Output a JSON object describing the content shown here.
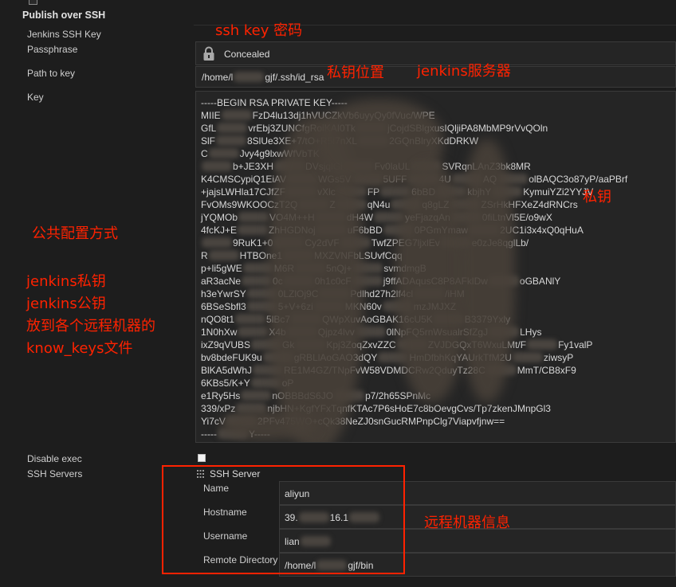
{
  "section_title": "Publish over SSH",
  "fields": {
    "jenkins_ssh_key_label": "Jenkins SSH Key",
    "passphrase_label": "Passphrase",
    "passphrase_icon": "lock-icon",
    "passphrase_value": "Concealed",
    "path_to_key_label": "Path to key",
    "path_to_key_value": [
      "/home/l",
      "gjf/.ssh/id_rsa"
    ],
    "key_label": "Key",
    "key_lines": [
      [
        "-----BEGIN RSA PRIVATE KEY-----"
      ],
      [
        "MIIE",
        "FzD4lu13dj1hVUCZkVb6uyyQy0fVuc/WPE"
      ],
      [
        "GfL",
        "vrEbj3ZUNCfgRoiKAI0Tk",
        "jCojdSBlgxusIQljiPA8MbMP9rVvQOln"
      ],
      [
        "SlF",
        "8SlUe3XE+7/tO+R5i7nXL",
        "2GQnBlryXKdDRKW"
      ],
      [
        "C",
        "Jvy4g9lxwWfVbTK"
      ],
      [
        "",
        "b+JE3XH",
        "DVsjqlGi",
        "Fv0laUL",
        "SVRqnLAnZ3bk8MR"
      ],
      [
        "K4CMSCypiQ1EiAV",
        "WGs5V",
        "5UFF",
        "4U",
        "AQ",
        "olBAQC3o87yP/aaPBrf"
      ],
      [
        "+jajsLWHla17CJfZF",
        "vXlc",
        "FP",
        "6bBD",
        "kbjhY",
        "KymuiYZi2YYJV"
      ],
      [
        "FvOMs9WKOOCzT2Q",
        "Z",
        "qN4u",
        "q8gLZ",
        "ZSrHkHFXeZ4dRNCrs"
      ],
      [
        "jYQMOb",
        "VO4M++H",
        "dH4W",
        "yeFjazqAn",
        "0fiLtnVl5E/o9wX"
      ],
      [
        "4fcKJ+E",
        "ZhHGDNoj",
        "uF6bBD",
        "0PGmYmaw",
        "2UC1i3x4xQ0qHuA"
      ],
      [
        "",
        "9RuK1+0",
        "Cy2dVF",
        "TwfZPEG7ljxlEv",
        "e0zJe8qglLb/"
      ],
      [
        "R",
        "HTBOne1",
        "MXZVNFbLSUvfCqq"
      ],
      [
        "p+li5gWE",
        "M6R",
        "5nQj+",
        "svmdmgB"
      ],
      [
        "aR3acNe",
        "0c",
        "0h1c0cF",
        "j9ffADAqusC8P8AFklDw",
        "oGBANlY"
      ],
      [
        "h3eYwrSY",
        "0LZlOj9C",
        "Pdlhd27h2lf4cl",
        "/iHM"
      ],
      [
        "6BSeSbfl3",
        "5+V+6zi",
        "MKN60v",
        "mzJMJXZ"
      ],
      [
        "nQO8t1",
        "5lBc7",
        "QWpXuvAoGBAK16cU5K",
        "B3379Yxly"
      ],
      [
        "1N0hXw",
        "X4b",
        "Qjpz4lvv",
        "0lNpFQ5rnWsualrSfZgJ",
        "LHys"
      ],
      [
        "ixZ9qVUBS",
        "Gk",
        "Kpj3ZoqZxvZZC",
        "ZVJDGQxT6WxuLMt/F",
        "Fy1valP"
      ],
      [
        "bv8bdeFUK9u",
        "gRBLlAoGAO3dQY",
        "HmDfbhKqYAUrkTfM2U",
        "ziwsyP"
      ],
      [
        "BlKA5dWhJ",
        "RE1M4GZ/TNpFvW58VDMDCRw2QduyTz28C",
        "MmT/CB8xF9"
      ],
      [
        "6KBs5/K+Y",
        "oP"
      ],
      [
        "e1Ry5Hs",
        "nOBBBdS6JO",
        "p7/2h65SPnMc"
      ],
      [
        "339/xPz",
        "njbHN+KgfYFxTqnfKTAc7P6sHoE7c8bOevgCvs/Tp7zkenJMnpGl3"
      ],
      [
        "Yi7cV",
        "2PFv475WO+cQk38NeZJ0snGucRMPnpClg7Viapvfjnw=="
      ],
      [
        "-----",
        "Y-----"
      ]
    ],
    "disable_exec_label": "Disable exec",
    "disable_exec_checked": false,
    "ssh_servers_label": "SSH Servers"
  },
  "ssh_server": {
    "drag_icon": "grip-icon",
    "title": "SSH Server",
    "name_label": "Name",
    "name_value": "aliyun",
    "hostname_label": "Hostname",
    "hostname_value": [
      "39.",
      "16.1",
      ""
    ],
    "username_label": "Username",
    "username_value": [
      "lian",
      ""
    ],
    "remote_directory_label": "Remote Directory",
    "remote_directory_value": [
      "/home/l",
      "gjf/bin"
    ]
  },
  "annotations": {
    "ssh_key_password": "ssh key 密码",
    "key_location": "私钥位置",
    "jenkins_server": "jenkins服务器",
    "private_key": "私钥",
    "common_config": "公共配置方式",
    "distribute_keys": [
      "jenkins私钥",
      "jenkins公钥",
      "放到各个远程机器的",
      "know_keys文件"
    ],
    "remote_machine_info": "远程机器信息"
  },
  "colors": {
    "background": "#1d1d1d",
    "field": "#252525",
    "annotation": "#ff2200"
  }
}
